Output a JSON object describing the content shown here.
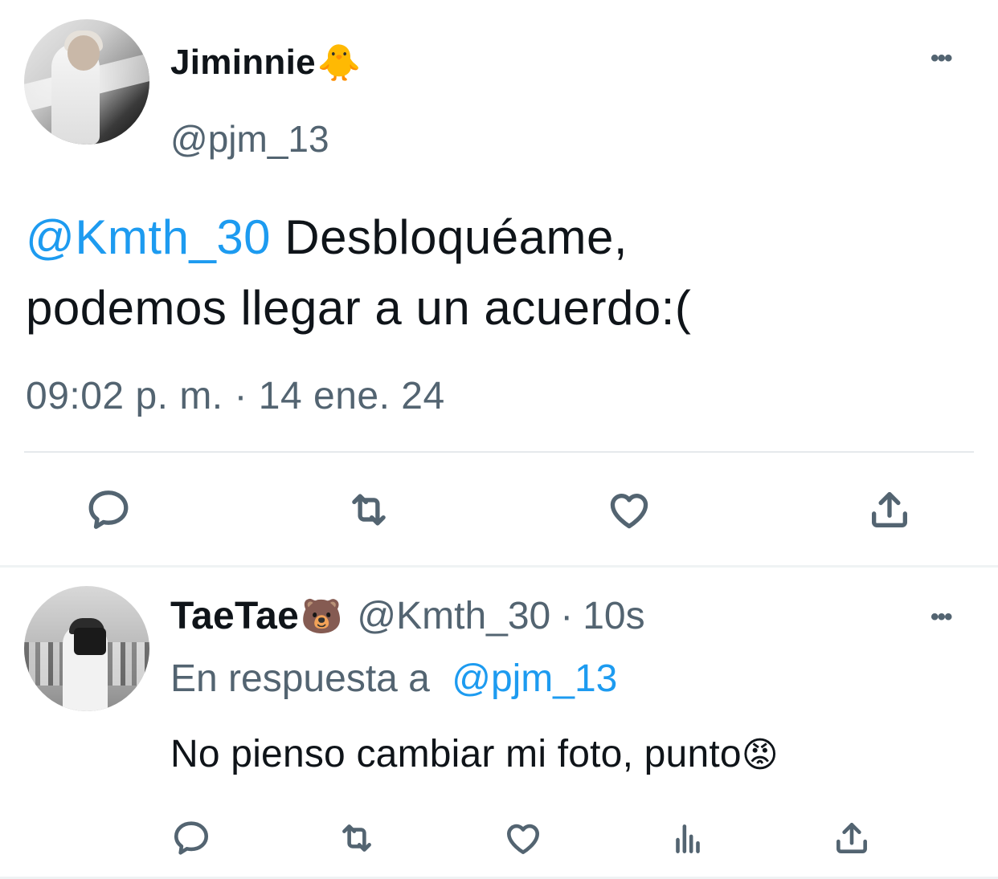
{
  "main_tweet": {
    "author_name": "Jiminnie",
    "author_emoji": "🐥",
    "handle": "@pjm_13",
    "mention": "@Kmth_30",
    "text_line1": " Desbloquéame,",
    "text_line2": "podemos llegar a un acuerdo:(",
    "timestamp": "09:02 p. m. · 14 ene. 24",
    "more_icon": "more-horizontal-icon",
    "actions": [
      "reply-icon",
      "retweet-icon",
      "like-icon",
      "share-icon"
    ]
  },
  "reply_tweet": {
    "author_name": "TaeTae",
    "author_emoji": "🐻",
    "handle": "@Kmth_30",
    "separator": "·",
    "time_ago": "10s",
    "reply_prefix": "En respuesta a",
    "reply_mention": "@pjm_13",
    "text": "No pienso cambiar mi foto, punto",
    "text_emoji": "😡",
    "more_icon": "more-horizontal-icon",
    "actions": [
      "reply-icon",
      "retweet-icon",
      "like-icon",
      "analytics-icon",
      "share-icon"
    ]
  },
  "colors": {
    "text": "#0f1419",
    "secondary": "#536471",
    "mention": "#1d9bf0",
    "divider": "#e6e9ec"
  }
}
